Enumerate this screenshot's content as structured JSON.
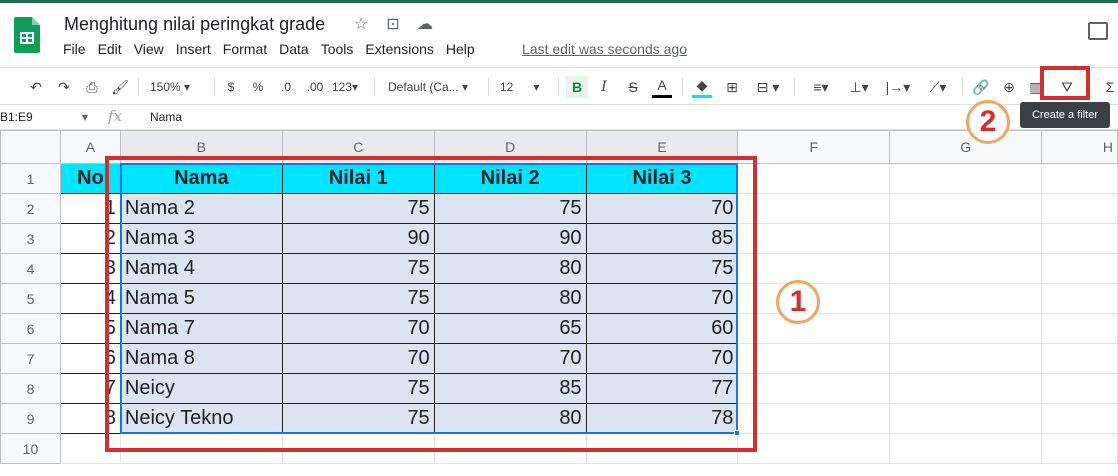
{
  "app": {
    "doc_title": "Menghitung nilai peringkat grade",
    "last_edit": "Last edit was seconds ago",
    "menu": [
      "File",
      "Edit",
      "View",
      "Insert",
      "Format",
      "Data",
      "Tools",
      "Extensions",
      "Help"
    ]
  },
  "toolbar": {
    "zoom": "150%",
    "currency": "$",
    "percent": "%",
    "dec_decrease": ".0",
    "dec_increase": ".00",
    "more_formats": "123",
    "font": "Default (Ca...",
    "font_size": "12",
    "bold": "B",
    "italic": "I",
    "strike": "S",
    "text_color": "A",
    "filter_tooltip": "Create a filter"
  },
  "formula_bar": {
    "name_box": "B1:E9",
    "fx": "fx",
    "value": "Nama"
  },
  "columns": [
    "A",
    "B",
    "C",
    "D",
    "E",
    "F",
    "G",
    "H"
  ],
  "table": {
    "headers": [
      "No",
      "Nama",
      "Nilai 1",
      "Nilai 2",
      "Nilai 3"
    ],
    "rows": [
      {
        "no": "1",
        "nama": "Nama 2",
        "n1": "75",
        "n2": "75",
        "n3": "70"
      },
      {
        "no": "2",
        "nama": "Nama 3",
        "n1": "90",
        "n2": "90",
        "n3": "85"
      },
      {
        "no": "3",
        "nama": "Nama 4",
        "n1": "75",
        "n2": "80",
        "n3": "75"
      },
      {
        "no": "4",
        "nama": "Nama 5",
        "n1": "75",
        "n2": "80",
        "n3": "70"
      },
      {
        "no": "5",
        "nama": "Nama 7",
        "n1": "70",
        "n2": "65",
        "n3": "60"
      },
      {
        "no": "6",
        "nama": "Nama 8",
        "n1": "70",
        "n2": "70",
        "n3": "70"
      },
      {
        "no": "7",
        "nama": "Neicy",
        "n1": "75",
        "n2": "85",
        "n3": "77"
      },
      {
        "no": "8",
        "nama": "Neicy Tekno",
        "n1": "75",
        "n2": "80",
        "n3": "78"
      }
    ]
  },
  "row_numbers": [
    "1",
    "2",
    "3",
    "4",
    "5",
    "6",
    "7",
    "8",
    "9",
    "10"
  ],
  "annotations": {
    "step1": "1",
    "step2": "2"
  },
  "colors": {
    "header_fill": "#00e5ff",
    "data_fill": "#dce3f1",
    "annotation_red": "#d32f2f",
    "selection_blue": "#1a73e8"
  }
}
